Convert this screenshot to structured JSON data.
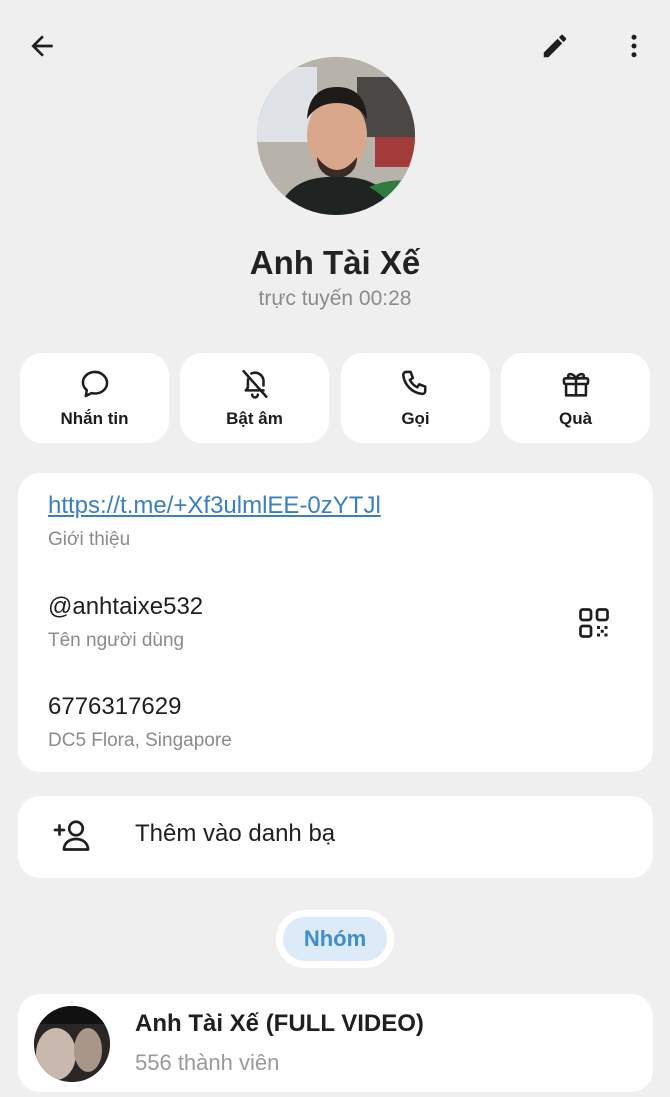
{
  "header": {
    "back_icon": "arrow-left-icon",
    "edit_icon": "pencil-icon",
    "more_icon": "more-vertical-icon"
  },
  "profile": {
    "name": "Anh Tài Xế",
    "status": "trực tuyến 00:28"
  },
  "actions": [
    {
      "label": "Nhắn tin",
      "icon": "message-icon"
    },
    {
      "label": "Bật âm",
      "icon": "bell-off-icon"
    },
    {
      "label": "Gọi",
      "icon": "phone-icon"
    },
    {
      "label": "Quà",
      "icon": "gift-icon"
    }
  ],
  "info": {
    "bio_link": "https://t.me/+Xf3ulmlEE-0zYTJl",
    "bio_label": "Giới thiệu",
    "username": "@anhtaixe532",
    "username_label": "Tên người dùng",
    "phone": "6776317629",
    "phone_label": "DC5 Flora, Singapore",
    "qr_icon": "qr-code-icon"
  },
  "add_contact": {
    "label": "Thêm vào danh bạ",
    "icon": "add-user-icon"
  },
  "section": {
    "label": "Nhóm"
  },
  "group": {
    "title": "Anh Tài Xế (FULL VIDEO)",
    "members": "556 thành viên"
  },
  "colors": {
    "background": "#efeff0",
    "card": "#ffffff",
    "link": "#3a7fbf",
    "pill_bg": "#dcebf7",
    "pill_text": "#3f8dcb",
    "muted": "#8b8b8b"
  }
}
